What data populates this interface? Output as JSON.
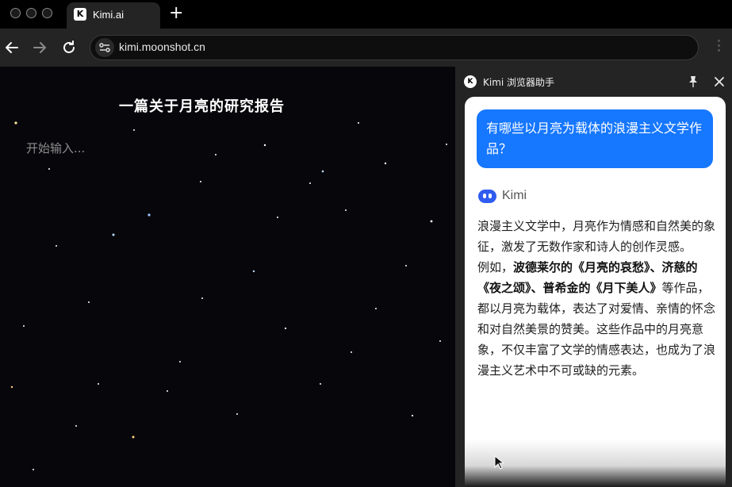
{
  "browser": {
    "tab": {
      "favicon": "K",
      "title": "Kimi.ai"
    },
    "new_tab_icon": "+",
    "address": {
      "url": "kimi.moonshot.cn"
    }
  },
  "page": {
    "title": "一篇关于月亮的研究报告",
    "placeholder": "开始输入..."
  },
  "sidebar": {
    "logo": "K",
    "title": "Kimi 浏览器助手",
    "user_message": "有哪些以月亮为载体的浪漫主义文学作品？",
    "assistant_name": "Kimi",
    "answer": {
      "p1": "浪漫主义文学中，月亮作为情感和自然美的象征，激发了无数作家和诗人的创作灵感。",
      "p2_prefix": "例如，",
      "p2_bold": "波德莱尔的《月亮的哀愁》、济慈的《夜之颂》、普希金的《月下美人》",
      "p2_suffix": "等作品，都以月亮为载体，表达了对爱情、亲情的怀念和对自然美景的赞美。这些作品中的月亮意象，不仅丰富了文学的情感表达，也成为了浪漫主义艺术中不可或缺的元素。"
    }
  },
  "colors": {
    "accent": "#1677ff",
    "kimi_avatar": "#2f5cf0"
  }
}
